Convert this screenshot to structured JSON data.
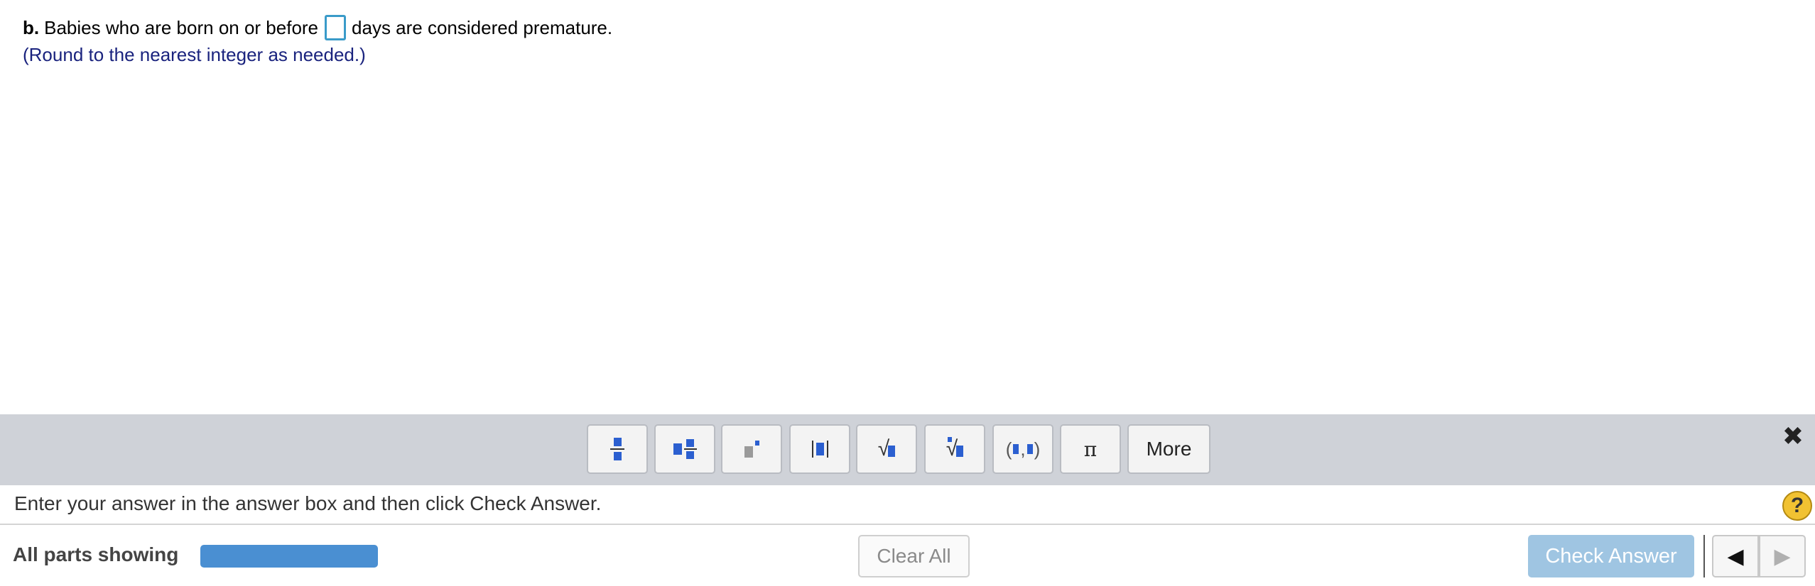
{
  "question": {
    "part_label": "b.",
    "text_before": "Babies who are born on or before",
    "answer_value": "",
    "text_after": "days are considered premature.",
    "hint": "(Round to the nearest integer as needed.)"
  },
  "palette": {
    "buttons": [
      {
        "name": "fraction-icon"
      },
      {
        "name": "mixed-number-icon"
      },
      {
        "name": "exponent-icon"
      },
      {
        "name": "absolute-value-icon"
      },
      {
        "name": "square-root-icon"
      },
      {
        "name": "nth-root-icon"
      },
      {
        "name": "ordered-pair-icon"
      },
      {
        "name": "pi-icon",
        "glyph": "π"
      }
    ],
    "more_label": "More",
    "close_glyph": "✖"
  },
  "instruction": {
    "text": "Enter your answer in the answer box and then click Check Answer.",
    "help_glyph": "?"
  },
  "footer": {
    "parts_label": "All parts showing",
    "progress_percent": 100,
    "clear_label": "Clear All",
    "check_label": "Check Answer",
    "prev_glyph": "◀",
    "next_glyph": "▶"
  },
  "colors": {
    "accent_blue": "#4a8fd2",
    "hint_navy": "#1a237e",
    "check_disabled": "#9fc5e2",
    "palette_bg": "#cfd2d8"
  }
}
